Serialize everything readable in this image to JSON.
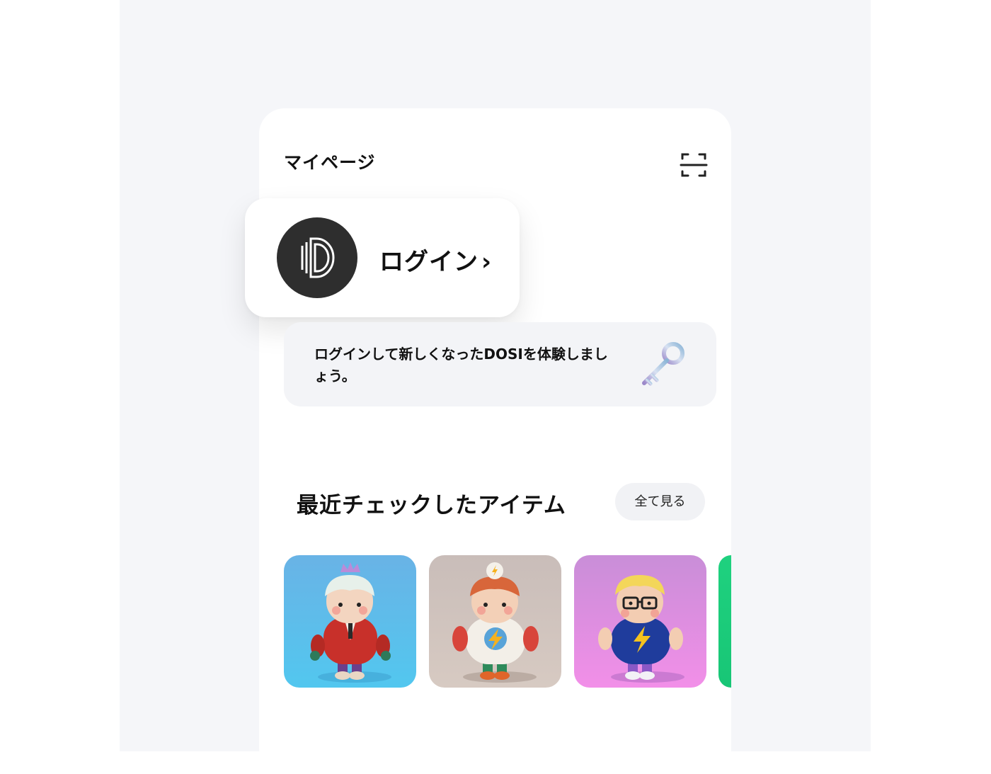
{
  "header": {
    "title": "マイページ",
    "scan_icon": "scan-frame-icon"
  },
  "login": {
    "label": "ログイン",
    "chevron": "›",
    "avatar_icon": "dosi-logo-icon"
  },
  "promo": {
    "text": "ログインして新しくなったDOSIを体験しましょう。",
    "icon": "key-icon"
  },
  "recent": {
    "title": "最近チェックしたアイテム",
    "see_all_label": "全て見る",
    "items": [
      {
        "icon": "character-king-icon",
        "bg_top": "#69b3e6",
        "bg_bottom": "#52c7ef"
      },
      {
        "icon": "character-lightning-beige-icon",
        "bg_top": "#c9bdb9",
        "bg_bottom": "#d7cac2"
      },
      {
        "icon": "character-glasses-purple-icon",
        "bg_top": "#c98ed8",
        "bg_bottom": "#f28fe8"
      },
      {
        "icon": "character-green-icon",
        "bg_top": "#1fd17f",
        "bg_bottom": "#18c676"
      }
    ]
  },
  "colors": {
    "background": "#f5f6f9",
    "card": "#ffffff",
    "promo_bg": "#f3f4f7",
    "avatar_bg": "#2e2e2e"
  }
}
